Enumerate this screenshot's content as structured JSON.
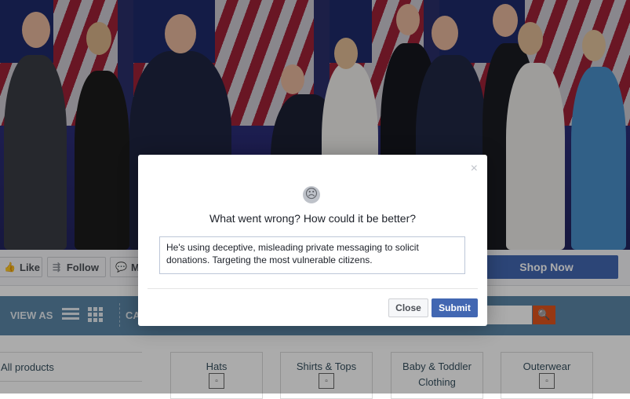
{
  "page": {
    "actions": {
      "like_label": "Like",
      "follow_label": "Follow",
      "message_label": "M",
      "shop_now_label": "Shop Now"
    },
    "view_bar": {
      "view_as_label": "VIEW AS",
      "category_label": "CA"
    },
    "catalog": {
      "all_products_label": "All products",
      "categories": [
        {
          "label": "Hats"
        },
        {
          "label": "Shirts & Tops"
        },
        {
          "label": "Baby & Toddler Clothing"
        },
        {
          "label": "Outerwear"
        }
      ]
    }
  },
  "dialog": {
    "title": "What went wrong? How could it be better?",
    "feedback_text": "He's using deceptive, misleading private messaging to solicit donations. Targeting the most vulnerable citizens.",
    "close_icon": "×",
    "sad_icon": "☹",
    "close_label": "Close",
    "submit_label": "Submit"
  },
  "colors": {
    "primary_blue": "#4267b2",
    "view_bar": "#5b87a7",
    "search_orange": "#e0541d"
  }
}
